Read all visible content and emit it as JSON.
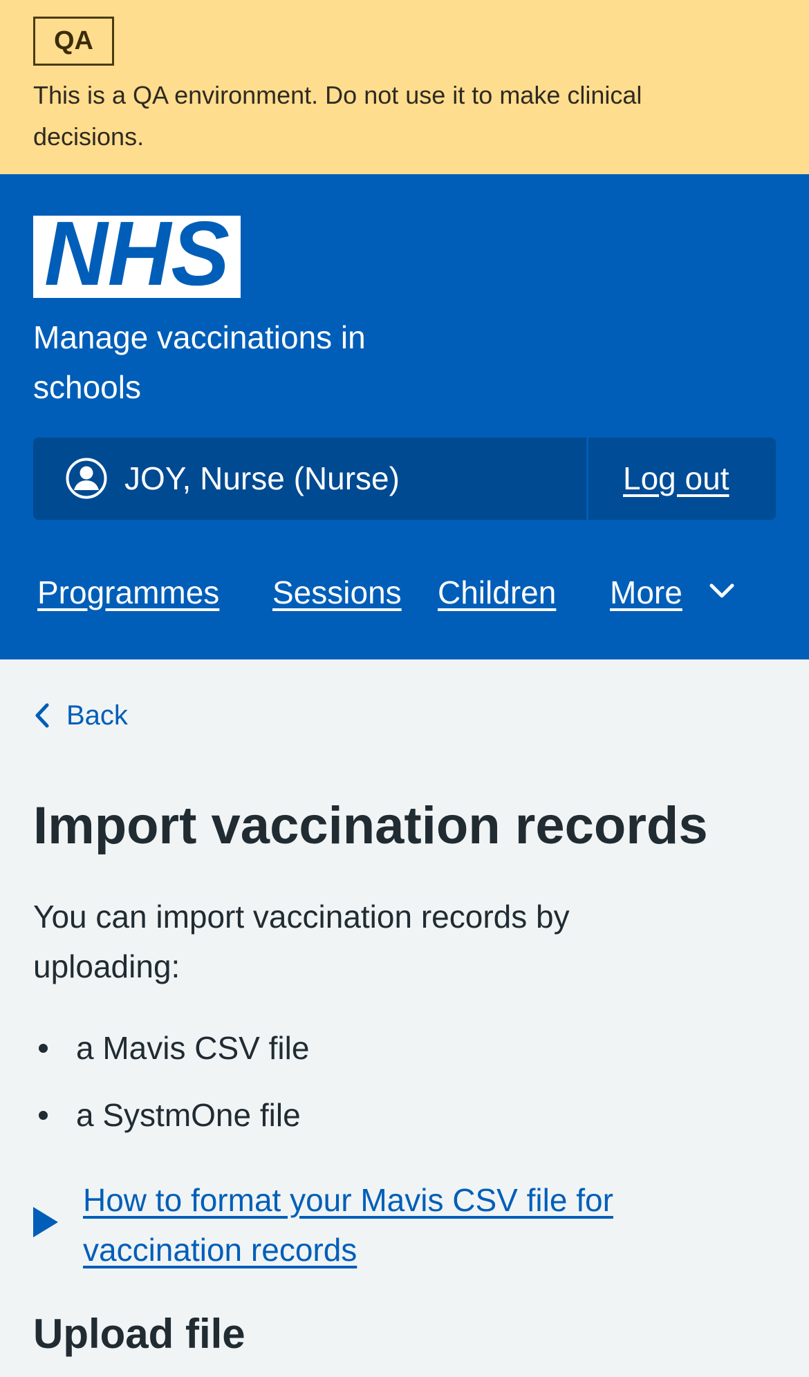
{
  "qa_banner": {
    "tag": "QA",
    "message": "This is a QA environment. Do not use it to make clinical decisions."
  },
  "header": {
    "logo_text": "NHS",
    "service_name": "Manage vaccinations in schools",
    "account": {
      "user": "JOY, Nurse (Nurse)",
      "logout": "Log out"
    },
    "nav": {
      "items": [
        "Programmes",
        "Sessions",
        "Children"
      ],
      "more": "More"
    }
  },
  "main": {
    "back": "Back",
    "title": "Import vaccination records",
    "intro": "You can import vaccination records by uploading:",
    "bullets": [
      "a Mavis CSV file",
      "a SystmOne file"
    ],
    "details_summary": "How to format your Mavis CSV file for vaccination records",
    "upload_heading": "Upload file"
  },
  "colors": {
    "qa_banner": "#ffdd8e",
    "nhs_blue": "#005eb8",
    "account_bar": "#004a92",
    "page_background": "#f0f4f5",
    "text": "#212b32"
  }
}
